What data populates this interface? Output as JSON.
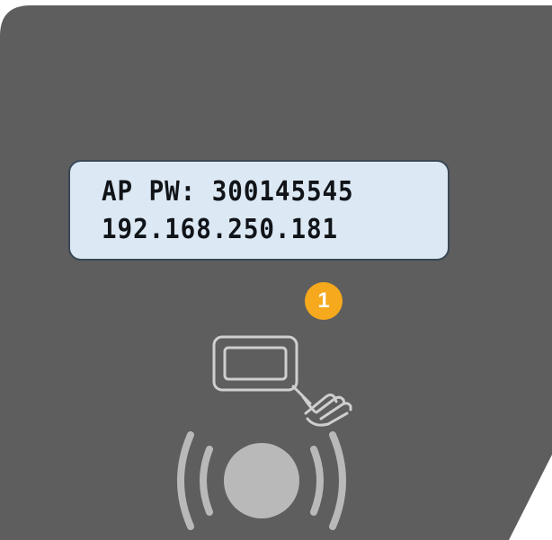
{
  "display": {
    "line1": "AP PW: 300145545",
    "line2": "192.168.250.181"
  },
  "step": {
    "number": "1"
  },
  "icons": {
    "tap": "hand-tap-card-icon",
    "nfc": "nfc-reader-icon"
  },
  "colors": {
    "panel": "#5e5e5e",
    "lcd_background": "#dce9f5",
    "lcd_border": "#3a4756",
    "badge": "#f6a91c",
    "icon_stroke": "#cfcfcf"
  }
}
